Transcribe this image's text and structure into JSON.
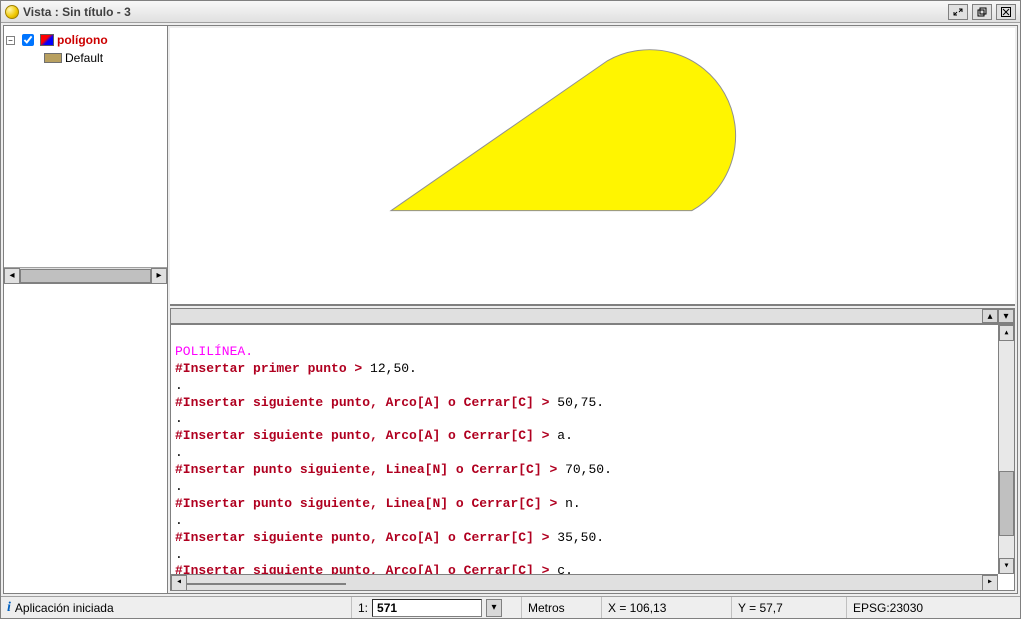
{
  "window": {
    "title": "Vista : Sin título  -  3"
  },
  "toc": {
    "layer_name": "polígono",
    "default_label": "Default"
  },
  "console": {
    "title": "POLILÍNEA.",
    "lines": [
      {
        "prompt": "#Insertar primer punto >",
        "entry": " 12,50."
      },
      {
        "prompt": "#Insertar siguiente punto, Arco[A] o Cerrar[C] >",
        "entry": " 50,75."
      },
      {
        "prompt": "#Insertar siguiente punto, Arco[A] o Cerrar[C] >",
        "entry": " a."
      },
      {
        "prompt": "#Insertar punto siguiente, Linea[N] o Cerrar[C] >",
        "entry": " 70,50."
      },
      {
        "prompt": "#Insertar punto siguiente, Linea[N] o Cerrar[C] >",
        "entry": " n."
      },
      {
        "prompt": "#Insertar siguiente punto, Arco[A] o Cerrar[C] >",
        "entry": " 35,50."
      },
      {
        "prompt": "#Insertar siguiente punto, Arco[A] o Cerrar[C] >",
        "entry": " c."
      }
    ]
  },
  "status": {
    "app_message": "Aplicación iniciada",
    "scale_prefix": "1:",
    "scale_value": "571",
    "units": "Metros",
    "x_label": "X = 106,13",
    "y_label": "Y = 57,7",
    "epsg": "EPSG:23030"
  },
  "shape": {
    "fill": "#fff500",
    "stroke": "#909090"
  }
}
